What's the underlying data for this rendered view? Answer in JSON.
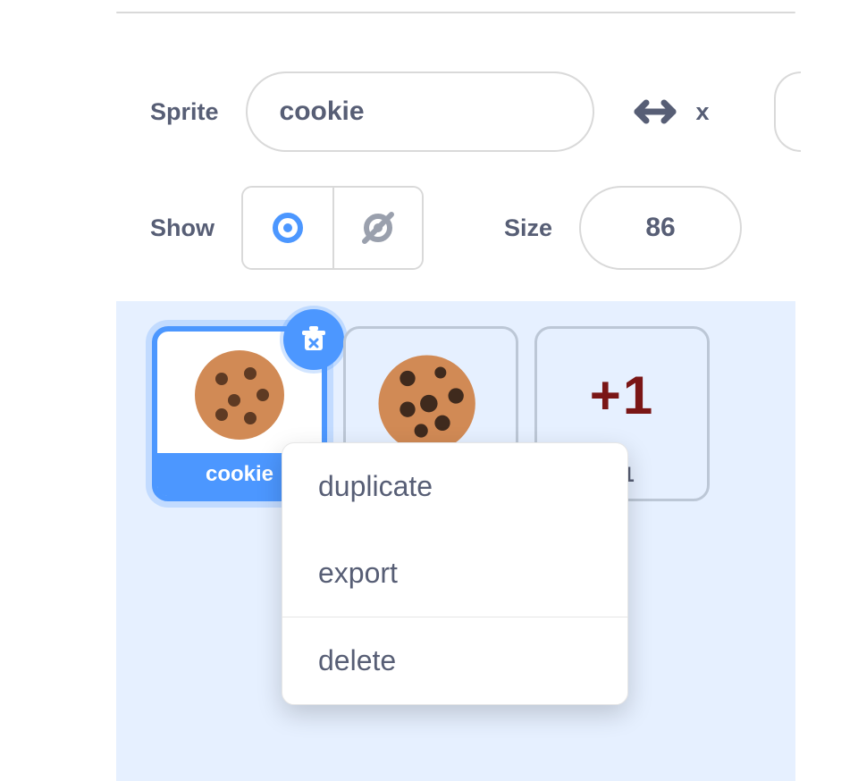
{
  "labels": {
    "sprite": "Sprite",
    "show": "Show",
    "size": "Size",
    "x": "x"
  },
  "fields": {
    "sprite_name": "cookie",
    "size_value": "86"
  },
  "sprites": [
    {
      "name": "cookie",
      "thumb_type": "cookie",
      "selected": true
    },
    {
      "name": "",
      "thumb_type": "cookie-alt",
      "selected": false
    },
    {
      "name": "+1",
      "thumb_type": "plus1",
      "selected": false
    }
  ],
  "sprite_thumbs": {
    "plus1_text": "+1"
  },
  "context_menu": {
    "duplicate": "duplicate",
    "export": "export",
    "delete": "delete"
  }
}
